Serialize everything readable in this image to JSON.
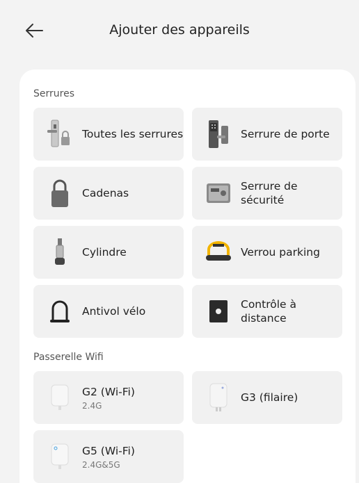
{
  "header": {
    "title": "Ajouter des appareils"
  },
  "sections": {
    "locks": {
      "title": "Serrures"
    },
    "gateways": {
      "title": "Passerelle Wifi"
    }
  },
  "locks": [
    {
      "label": "Toutes les serrures",
      "icon": "smart-lock-icon"
    },
    {
      "label": "Serrure de porte",
      "icon": "door-lock-icon"
    },
    {
      "label": "Cadenas",
      "icon": "padlock-icon"
    },
    {
      "label": "Serrure de sécurité",
      "icon": "safe-lock-icon"
    },
    {
      "label": "Cylindre",
      "icon": "cylinder-icon"
    },
    {
      "label": "Verrou parking",
      "icon": "parking-lock-icon"
    },
    {
      "label": "Antivol vélo",
      "icon": "bike-lock-icon"
    },
    {
      "label": "Contrôle à distance",
      "icon": "remote-control-icon"
    }
  ],
  "gateways": [
    {
      "label": "G2 (Wi-Fi)",
      "sub": "2.4G",
      "icon": "gateway-g2-icon"
    },
    {
      "label": "G3 (filaire)",
      "icon": "gateway-g3-icon"
    },
    {
      "label": "G5 (Wi-Fi)",
      "sub": "2.4G&5G",
      "icon": "gateway-g5-icon"
    }
  ]
}
